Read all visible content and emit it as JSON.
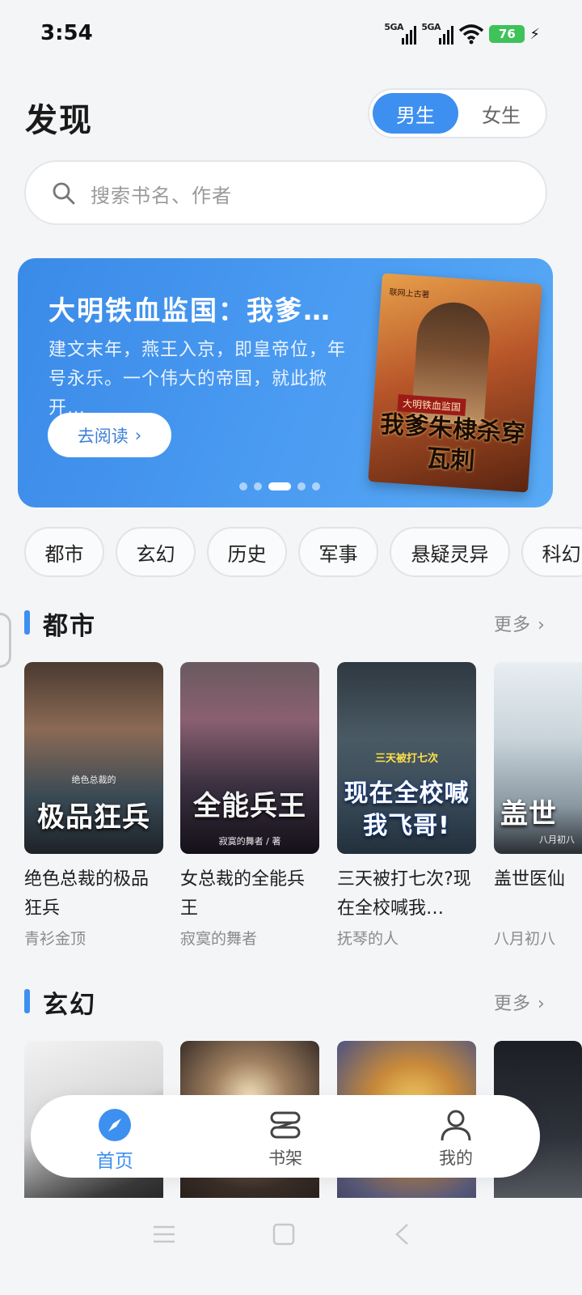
{
  "status": {
    "time": "3:54",
    "signal1": "5GA",
    "signal2": "5GA",
    "battery": "76"
  },
  "header": {
    "title": "发现",
    "gender_male": "男生",
    "gender_female": "女生",
    "selected_gender": "男生"
  },
  "search": {
    "placeholder": "搜索书名、作者"
  },
  "banner": {
    "title": "大明铁血监国：我爹…",
    "description": "建文末年，燕王入京，即皇帝位，年号永乐。一个伟大的帝国，就此掀开…",
    "button_label": "去阅读",
    "button_arrow": "›",
    "cover_author": "联网上古著",
    "cover_subtitle": "大明铁血监国",
    "cover_title": "我爹朱棣杀穿瓦刺",
    "page_count": 5,
    "active_page": 3
  },
  "categories": [
    "都市",
    "玄幻",
    "历史",
    "军事",
    "悬疑灵异",
    "科幻"
  ],
  "sections": [
    {
      "title": "都市",
      "more_label": "更多 ›",
      "books": [
        {
          "name": "绝色总裁的极品狂兵",
          "author": "青衫金顶",
          "cover_text": "极品狂兵",
          "cover_small": "绝色总裁的"
        },
        {
          "name": "女总裁的全能兵王",
          "author": "寂寞的舞者",
          "cover_text": "全能兵王",
          "cover_small": "寂寞的舞者 / 著"
        },
        {
          "name": "三天被打七次?现在全校喊我…",
          "author": "抚琴的人",
          "cover_text": "现在全校喊我飞哥!",
          "cover_small": "三天被打七次"
        },
        {
          "name": "盖世医仙",
          "author": "八月初八",
          "cover_text": "盖世",
          "cover_small": "八月初八"
        }
      ]
    },
    {
      "title": "玄幻",
      "more_label": "更多 ›",
      "books": []
    }
  ],
  "bottom_nav": [
    {
      "label": "首页",
      "icon": "compass-icon",
      "active": true
    },
    {
      "label": "书架",
      "icon": "bookshelf-icon",
      "active": false
    },
    {
      "label": "我的",
      "icon": "person-icon",
      "active": false
    }
  ],
  "colors": {
    "accent": "#3d8ff0",
    "background": "#f4f5f7",
    "banner": "#4b9cf2"
  }
}
